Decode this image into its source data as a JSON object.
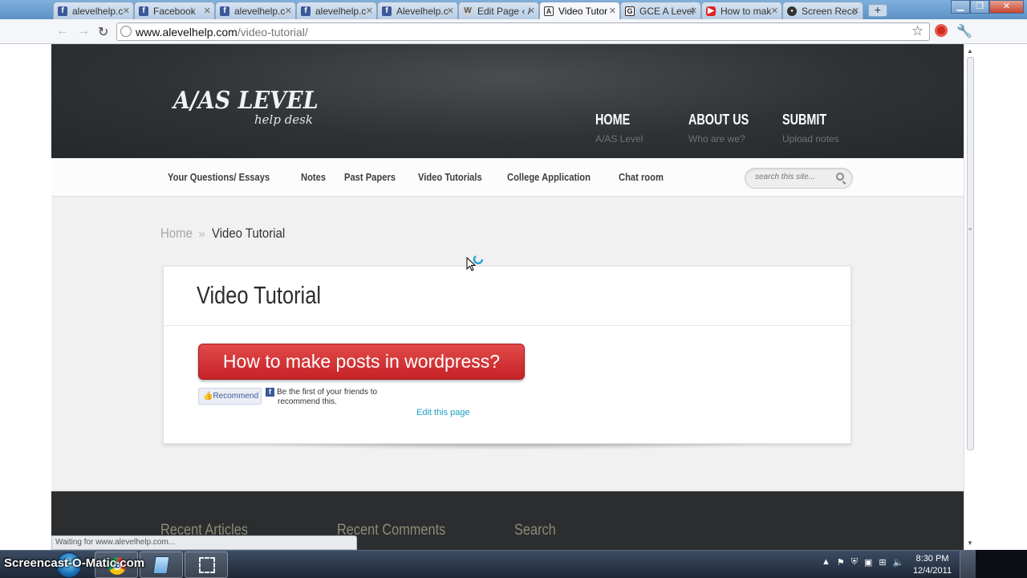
{
  "browser": {
    "tabs": [
      {
        "label": "alevelhelp.c",
        "icon": "facebook-icon"
      },
      {
        "label": "Facebook",
        "icon": "facebook-icon"
      },
      {
        "label": "alevelhelp.c",
        "icon": "facebook-icon"
      },
      {
        "label": "alevelhelp.c",
        "icon": "facebook-icon"
      },
      {
        "label": "Alevelhelp.c",
        "icon": "facebook-icon"
      },
      {
        "label": "Edit Page ‹ /",
        "icon": "wordpress-icon"
      },
      {
        "label": "Video Tutor",
        "icon": "site-icon",
        "active": true
      },
      {
        "label": "GCE A Level",
        "icon": "gce-icon"
      },
      {
        "label": "How to mak",
        "icon": "youtube-icon"
      },
      {
        "label": "Screen Reco",
        "icon": "screencast-icon"
      }
    ],
    "url_host": "www.alevelhelp.com",
    "url_path": "/video-tutorial/"
  },
  "site": {
    "logo_main": "A/AS LEVEL",
    "logo_sub": "help desk",
    "main_nav": [
      {
        "title": "HOME",
        "subtitle": "A/AS Level"
      },
      {
        "title": "ABOUT US",
        "subtitle": "Who are we?"
      },
      {
        "title": "SUBMIT",
        "subtitle": "Upload notes"
      }
    ],
    "sub_nav": [
      "Your Questions/ Essays",
      "Notes",
      "Past Papers",
      "Video Tutorials",
      "College Application",
      "Chat room"
    ],
    "search_placeholder": "search this site..."
  },
  "breadcrumb": {
    "home": "Home",
    "separator": "»",
    "current": "Video Tutorial"
  },
  "content": {
    "page_title": "Video Tutorial",
    "post_button": "How to make posts in wordpress?",
    "recommend_label": "Recommend",
    "fb_text_line1": "Be the first of your friends to",
    "fb_text_line2": "recommend this.",
    "edit_link": "Edit this page"
  },
  "footer": {
    "headings": [
      "Recent Articles",
      "Recent Comments",
      "Search"
    ]
  },
  "status": {
    "text": "Waiting for www.alevelhelp.com..."
  },
  "taskbar": {
    "watermark": "Screencast-O-Matic.com",
    "time": "8:30 PM",
    "date": "12/4/2011"
  },
  "colors": {
    "header_bg": "#2f3234",
    "button_red": "#d1292d",
    "link_blue": "#1b9fc4",
    "footer_bg": "#2b2d2f"
  }
}
